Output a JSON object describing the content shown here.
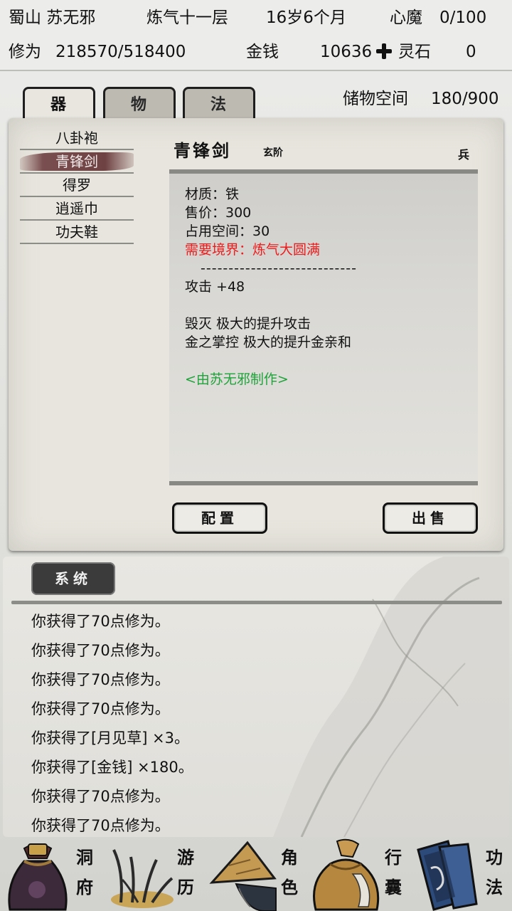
{
  "status": {
    "sect_name": "蜀山 苏无邪",
    "realm": "炼气十一层",
    "age": "16岁6个月",
    "demon_label": "心魔",
    "demon_value": "0/100",
    "cultivation_label": "修为",
    "cultivation_value": "218570/518400",
    "money_label": "金钱",
    "money_value": "10636",
    "stone_label": "灵石",
    "stone_value": "0"
  },
  "tabs": [
    {
      "label": "器",
      "active": true
    },
    {
      "label": "物",
      "active": false
    },
    {
      "label": "法",
      "active": false
    }
  ],
  "storage": {
    "label": "储物空间",
    "value": "180/900"
  },
  "items": [
    {
      "label": "八卦袍",
      "selected": false
    },
    {
      "label": "青锋剑",
      "selected": true
    },
    {
      "label": "得罗",
      "selected": false
    },
    {
      "label": "逍遥巾",
      "selected": false
    },
    {
      "label": "功夫鞋",
      "selected": false
    }
  ],
  "detail": {
    "name": "青锋剑",
    "grade": "玄阶",
    "type": "兵",
    "material": "材质：铁",
    "price": "售价：300",
    "space": "占用空间：30",
    "requirement": "需要境界：炼气大圆满",
    "divider": "----------------------------",
    "attack": "攻击 +48",
    "effect1": "毁灭 极大的提升攻击",
    "effect2": "金之掌控 极大的提升金亲和",
    "maker": "<由苏无邪制作>"
  },
  "buttons": {
    "equip": "配置",
    "sell": "出售"
  },
  "log": {
    "tab_label": "系统",
    "entries": [
      "你获得了70点修为。",
      "你获得了70点修为。",
      "你获得了70点修为。",
      "你获得了70点修为。",
      "你获得了[月见草] ×3。",
      "你获得了[金钱] ×180。",
      "你获得了70点修为。",
      "你获得了70点修为。"
    ]
  },
  "nav": [
    {
      "line1": "洞",
      "line2": "府",
      "icon": "treasure-bag-icon"
    },
    {
      "line1": "游",
      "line2": "历",
      "icon": "grass-icon"
    },
    {
      "line1": "角",
      "line2": "色",
      "icon": "straw-hat-icon"
    },
    {
      "line1": "行",
      "line2": "囊",
      "icon": "cloth-bundle-icon"
    },
    {
      "line1": "功",
      "line2": "法",
      "icon": "scroll-books-icon"
    }
  ],
  "colors": {
    "requirement": "#ee1d1d",
    "maker": "#1fa33a",
    "selected_item": "#6e4142"
  }
}
